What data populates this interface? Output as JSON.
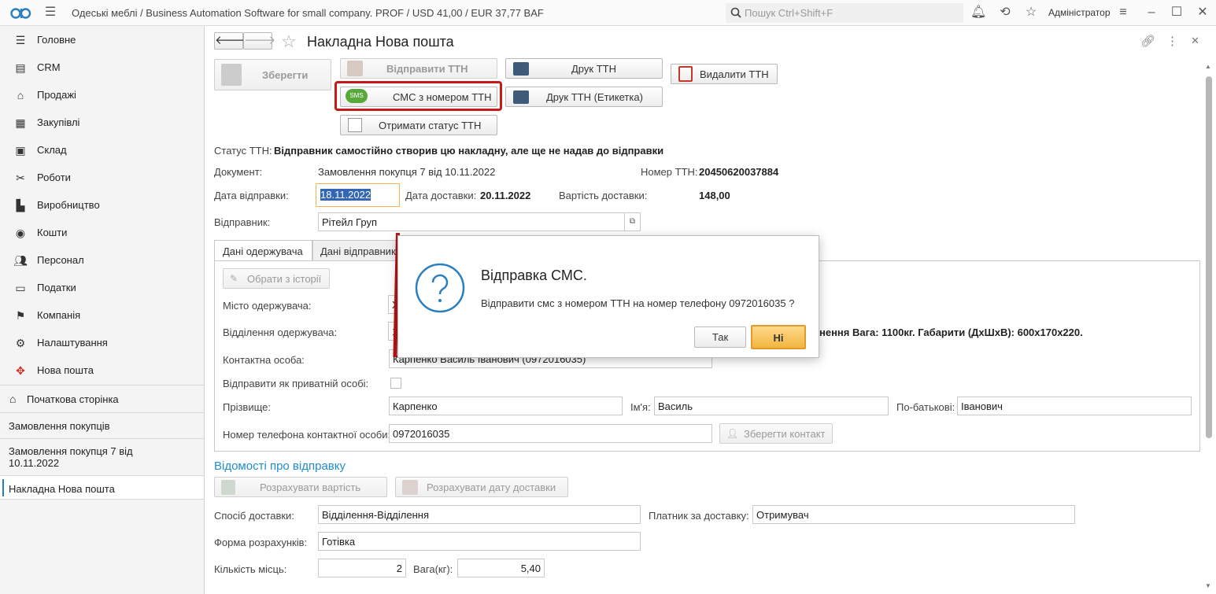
{
  "topbar": {
    "title": "Одеські меблі / Business Automation Software for small company. PROF / USD 41,00 / EUR 37,77 BAF",
    "search_placeholder": "Пошук Ctrl+Shift+F",
    "user": "Адміністратор"
  },
  "sidebar": {
    "items": [
      {
        "label": "Головне",
        "icon": "menu-icon"
      },
      {
        "label": "CRM",
        "icon": "crm-icon"
      },
      {
        "label": "Продажі",
        "icon": "basket-icon"
      },
      {
        "label": "Закупівлі",
        "icon": "purchases-icon"
      },
      {
        "label": "Склад",
        "icon": "warehouse-icon"
      },
      {
        "label": "Роботи",
        "icon": "tools-icon"
      },
      {
        "label": "Виробництво",
        "icon": "factory-icon"
      },
      {
        "label": "Кошти",
        "icon": "money-icon"
      },
      {
        "label": "Персонал",
        "icon": "people-icon"
      },
      {
        "label": "Податки",
        "icon": "taxes-icon"
      },
      {
        "label": "Компанія",
        "icon": "flag-icon"
      },
      {
        "label": "Налаштування",
        "icon": "gear-icon"
      },
      {
        "label": "Нова пошта",
        "icon": "nova-poshta-icon"
      }
    ],
    "open_windows": [
      "Початкова сторінка",
      "Замовлення покупців",
      "Замовлення покупця 7 від 10.11.2022",
      "Накладна Нова пошта"
    ]
  },
  "doc": {
    "title": "Накладна Нова пошта",
    "buttons": {
      "save": "Зберегти",
      "send_ttn": "Відправити ТТН",
      "print_ttn": "Друк ТТН",
      "delete_ttn": "Видалити ТТН",
      "sms_ttn": "СМС з номером ТТН",
      "print_label": "Друк ТТН (Етикетка)",
      "get_status": "Отримати статус ТТН",
      "sms_badge": "SMS"
    },
    "status_label": "Статус ТТН:",
    "status_value": "Відправник самостійно створив цю накладну, але ще не надав до відправки",
    "document_label": "Документ:",
    "document_value": "Замовлення покупця 7 від 10.11.2022",
    "ttn_number_label": "Номер ТТН:",
    "ttn_number_value": "20450620037884",
    "send_date_label": "Дата відправки:",
    "send_date_value": "18.11.2022",
    "delivery_date_label": "Дата доставки:",
    "delivery_date_value": "20.11.2022",
    "delivery_cost_label": "Вартість доставки:",
    "delivery_cost_value": "148,00",
    "sender_label": "Відправник:",
    "sender_value": "Рітейл Груп"
  },
  "tabs": {
    "recipient": "Дані одержувача",
    "sender": "Дані відправник"
  },
  "recipient": {
    "history_button": "Обрати з історії",
    "city_label": "Місто одержувача:",
    "city_value": "Х",
    "branch_label": "Відділення одержувача:",
    "branch_value": "1",
    "cargo_text": "нення Вага:  1100кг. Габарити (ДхШхВ): 600x170x220.",
    "contact_label": "Контактна особа:",
    "contact_value": "Карпенко Василь Іванович (0972016035)",
    "private_label": "Відправити як приватній особі:",
    "surname_label": "Прізвище:",
    "surname_value": "Карпенко",
    "name_label": "Ім'я:",
    "name_value": "Василь",
    "patronymic_label": "По-батькові:",
    "patronymic_value": "Іванович",
    "phone_label": "Номер телефона контактної особи:",
    "phone_value": "0972016035",
    "save_contact": "Зберегти контакт"
  },
  "shipment": {
    "section_title": "Відомості про відправку",
    "calc_cost": "Розрахувати вартість",
    "calc_date": "Розрахувати дату доставки",
    "method_label": "Спосіб доставки:",
    "method_value": "Відділення-Відділення",
    "payer_label": "Платник за доставку:",
    "payer_value": "Отримувач",
    "payment_label": "Форма розрахунків:",
    "payment_value": "Готівка",
    "places_label": "Кількість місць:",
    "places_value": "2",
    "weight_label": "Вага(кг):",
    "weight_value": "5,40"
  },
  "dialog": {
    "title": "Відправка СМС.",
    "message": "Відправити смс з номером ТТН на номер телефону 0972016035 ?",
    "yes": "Так",
    "no": "Ні"
  }
}
